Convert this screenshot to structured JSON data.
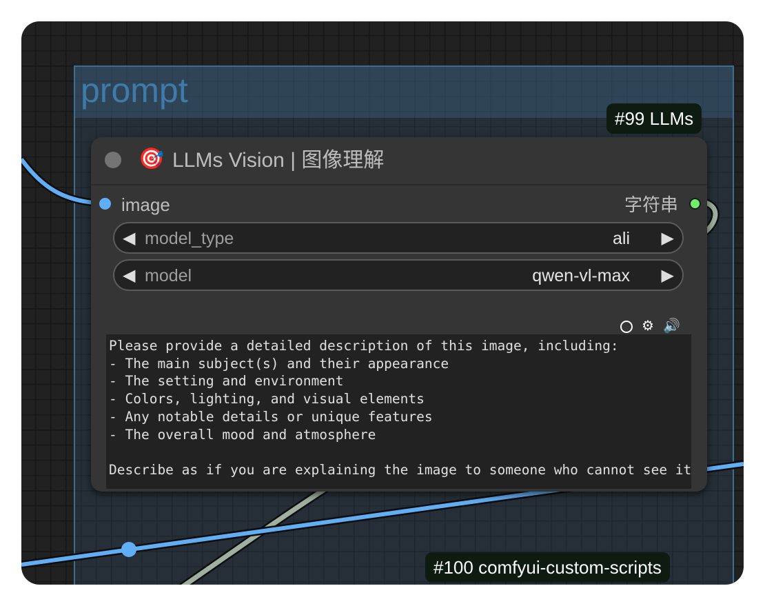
{
  "group": {
    "title": "prompt"
  },
  "badges": {
    "node_badge": "#99 LLMs",
    "bottom_badge": "#100 comfyui-custom-scripts"
  },
  "node": {
    "icon": "🎯",
    "title": "LLMs Vision | 图像理解",
    "input_slot": "image",
    "output_slot": "字符串",
    "widgets": [
      {
        "name": "model_type",
        "value": "ali"
      },
      {
        "name": "model",
        "value": "qwen-vl-max"
      }
    ],
    "prompt_text": "Please provide a detailed description of this image, including:\n- The main subject(s) and their appearance\n- The setting and environment\n- Colors, lighting, and visual elements\n- Any notable details or unique features\n- The overall mood and atmosphere\n\nDescribe as if you are explaining the image to someone who cannot see it.",
    "textarea_icons": [
      "circle-icon",
      "gear-icon",
      "speaker-icon"
    ]
  },
  "colors": {
    "image_link": "#62aef5",
    "string_link": "#9fb0a0",
    "output_dot": "#6ff06a",
    "group_border": "#3d6e92"
  }
}
